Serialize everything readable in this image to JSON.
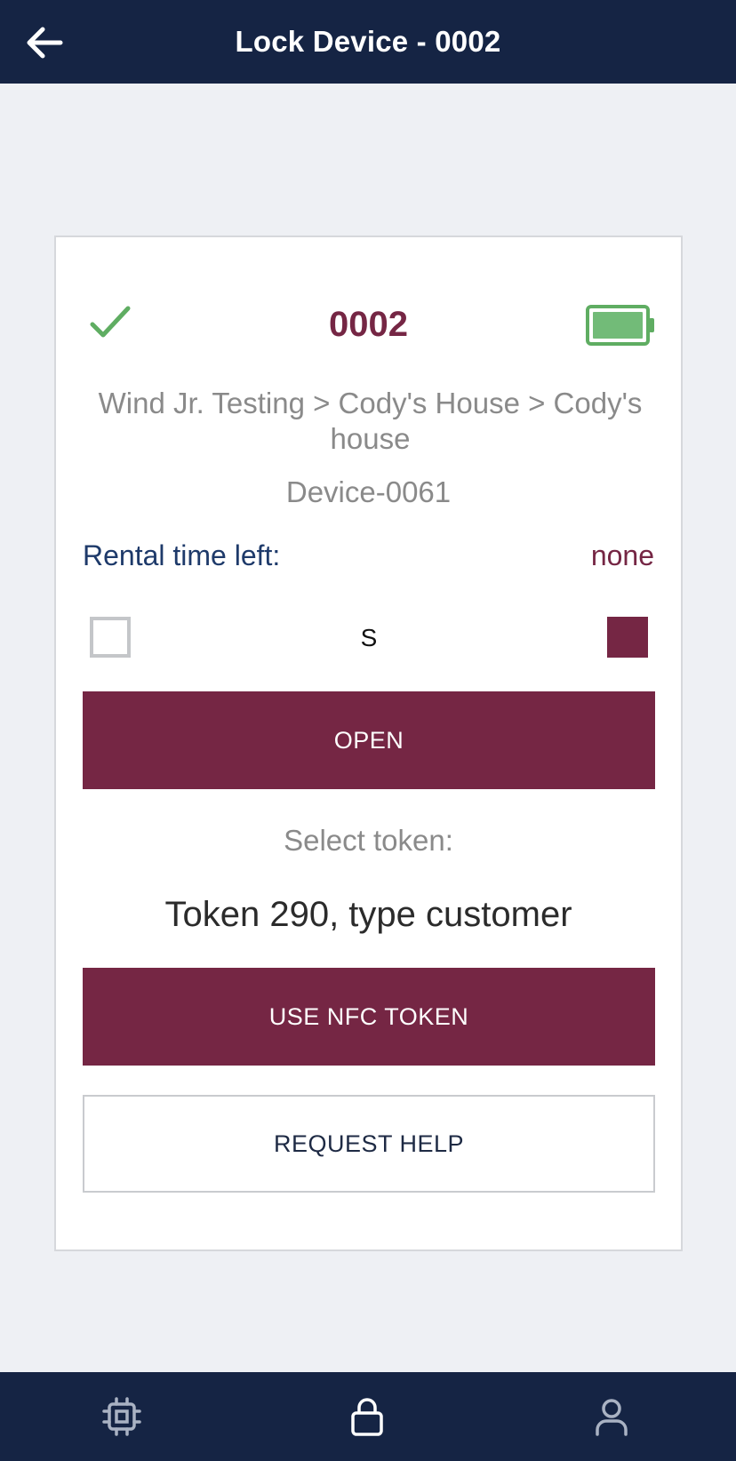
{
  "header": {
    "title": "Lock Device - 0002",
    "back_icon": "arrow-left-icon"
  },
  "card": {
    "status_icon": "checkmark-icon",
    "device_code": "0002",
    "battery_icon": "battery-full-icon",
    "path": "Wind Jr. Testing > Cody's House > Cody's house",
    "device_name": "Device-0061",
    "rental_label": "Rental time left:",
    "rental_value": "none",
    "mode_label": "S",
    "open_label": "OPEN",
    "select_token_label": "Select token:",
    "token_value": "Token 290, type customer",
    "nfc_label": "USE NFC TOKEN",
    "help_label": "REQUEST HELP"
  },
  "bottom_nav": {
    "items": [
      {
        "icon": "chip-icon"
      },
      {
        "icon": "lock-icon"
      },
      {
        "icon": "user-icon"
      }
    ]
  },
  "colors": {
    "header_bg": "#152444",
    "accent": "#752644",
    "success": "#5fad62",
    "link_blue": "#1e3a6a",
    "page_bg": "#eef0f4"
  }
}
